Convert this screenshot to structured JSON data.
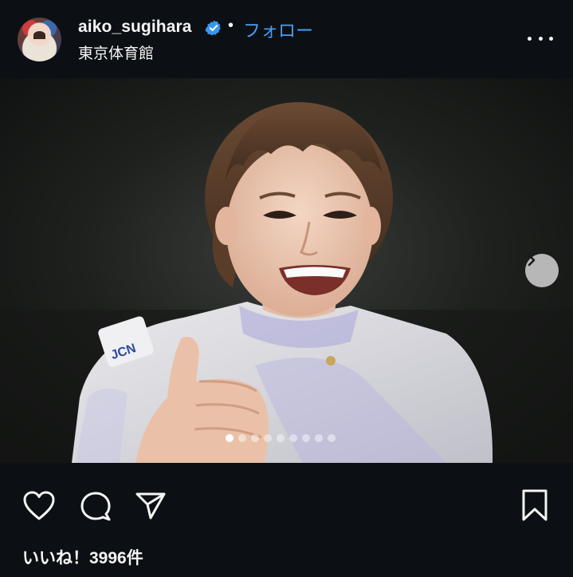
{
  "post": {
    "username": "aiko_sugihara",
    "separator": "•",
    "follow_label": "フォロー",
    "location": "東京体育館",
    "likes_text": "いいね！3996件"
  },
  "carousel": {
    "total_slides": 9,
    "current_slide": 1
  },
  "icons": {
    "verified": "verified-badge-icon",
    "more": "more-options-icon",
    "next": "chevron-right-icon",
    "like": "heart-icon",
    "comment": "comment-bubble-icon",
    "share": "paper-plane-icon",
    "save": "bookmark-icon"
  },
  "colors": {
    "background": "#0c1014",
    "link": "#4a9ef5",
    "verified": "#3897f0",
    "text": "#f5f5f5"
  }
}
